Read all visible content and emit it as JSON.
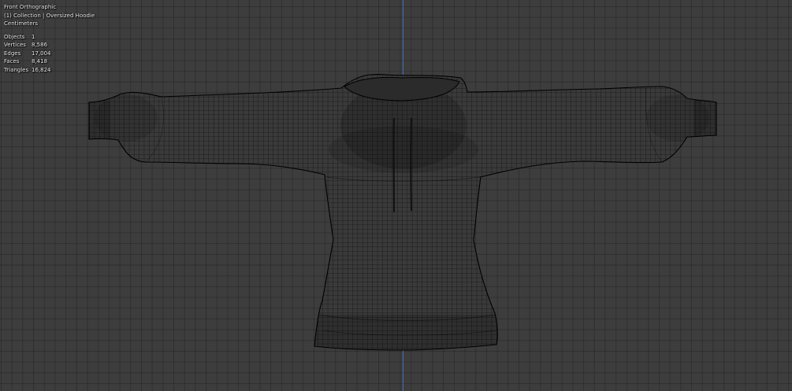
{
  "viewport": {
    "view_name": "Front Orthographic",
    "collection_label": "(1) Collection | Oversized Hoodie",
    "units": "Centimeters",
    "stats": [
      {
        "label": "Objects",
        "value": "1"
      },
      {
        "label": "Vertices",
        "value": "8,586"
      },
      {
        "label": "Edges",
        "value": "17,004"
      },
      {
        "label": "Faces",
        "value": "8,418"
      },
      {
        "label": "Triangles",
        "value": "16,824"
      }
    ]
  },
  "colors": {
    "background": "#3d3d3d",
    "grid": "#2e2e2e",
    "z_axis": "#3c7ad6",
    "wireframe": "#000000",
    "overlay_text": "#e6e6e6"
  },
  "object": {
    "icon": "hoodie-wireframe-mesh"
  }
}
